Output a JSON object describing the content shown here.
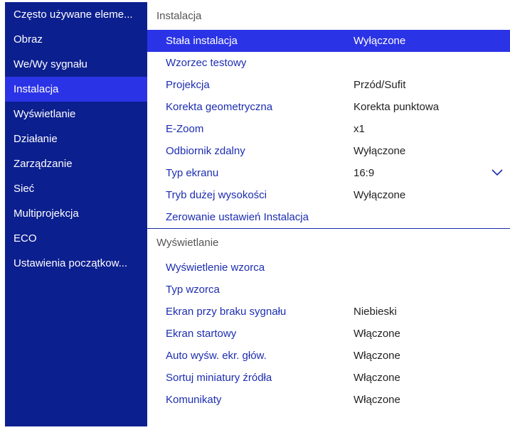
{
  "sidebar": {
    "items": [
      {
        "label": "Często używane eleme..."
      },
      {
        "label": "Obraz"
      },
      {
        "label": "We/Wy sygnału"
      },
      {
        "label": "Instalacja"
      },
      {
        "label": "Wyświetlanie"
      },
      {
        "label": "Działanie"
      },
      {
        "label": "Zarządzanie"
      },
      {
        "label": "Sieć"
      },
      {
        "label": "Multiprojekcja"
      },
      {
        "label": "ECO"
      },
      {
        "label": "Ustawienia początkow..."
      }
    ]
  },
  "sections": [
    {
      "title": "Instalacja",
      "rows": [
        {
          "label": "Stała instalacja",
          "value": "Wyłączone"
        },
        {
          "label": "Wzorzec testowy",
          "value": ""
        },
        {
          "label": "Projekcja",
          "value": "Przód/Sufit"
        },
        {
          "label": "Korekta geometryczna",
          "value": "Korekta punktowa"
        },
        {
          "label": "E-Zoom",
          "value": "x1"
        },
        {
          "label": "Odbiornik zdalny",
          "value": "Wyłączone"
        },
        {
          "label": "Typ ekranu",
          "value": "16:9"
        },
        {
          "label": "Tryb dużej wysokości",
          "value": "Wyłączone"
        },
        {
          "label": "Zerowanie ustawień Instalacja",
          "value": ""
        }
      ]
    },
    {
      "title": "Wyświetlanie",
      "rows": [
        {
          "label": "Wyświetlenie wzorca",
          "value": ""
        },
        {
          "label": "Typ wzorca",
          "value": ""
        },
        {
          "label": "Ekran przy braku sygnału",
          "value": "Niebieski"
        },
        {
          "label": "Ekran startowy",
          "value": "Włączone"
        },
        {
          "label": "Auto wyśw. ekr. głów.",
          "value": "Włączone"
        },
        {
          "label": "Sortuj miniatury źródła",
          "value": "Włączone"
        },
        {
          "label": "Komunikaty",
          "value": "Włączone"
        }
      ]
    }
  ],
  "colors": {
    "sidebar_bg": "#0c1f8f",
    "highlight": "#2b33e6",
    "link_text": "#1c2db0"
  },
  "icons": {
    "typ_ekranu_dropdown": "chevron-down-icon"
  }
}
